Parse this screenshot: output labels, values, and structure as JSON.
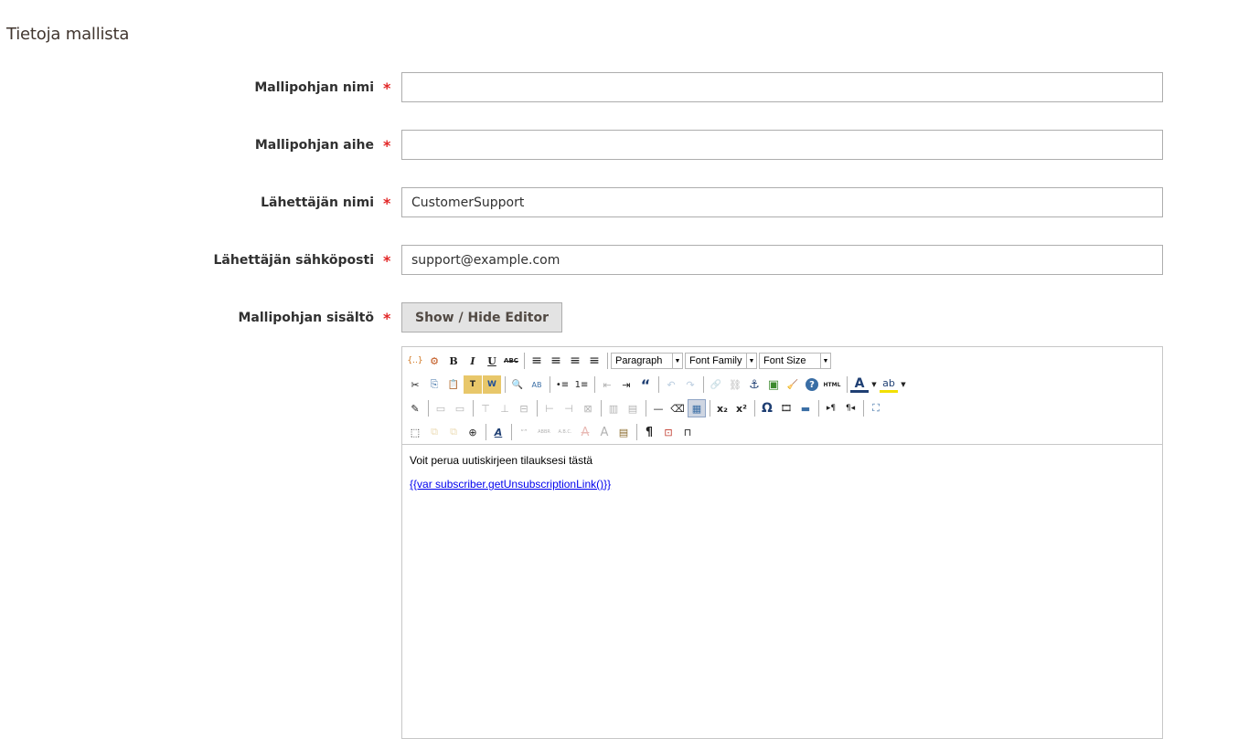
{
  "section": {
    "title": "Tietoja mallista"
  },
  "fields": [
    {
      "label": "Mallipohjan nimi",
      "required_mark": "*",
      "value": "",
      "placeholder": ""
    },
    {
      "label": "Mallipohjan aihe",
      "required_mark": "*",
      "value": "",
      "placeholder": ""
    },
    {
      "label": "Lähettäjän nimi",
      "required_mark": "*",
      "value": "CustomerSupport",
      "placeholder": ""
    },
    {
      "label": "Lähettäjän sähköposti",
      "required_mark": "*",
      "value": "support@example.com",
      "placeholder": ""
    }
  ],
  "content_field": {
    "label": "Mallipohjan sisältö",
    "required_mark": "*",
    "toggle_button": "Show / Hide Editor"
  },
  "toolbar": {
    "row1": {
      "icons": {
        "insert_variable": "{..}",
        "insert_widget": "⚙",
        "bold": "B",
        "italic": "I",
        "underline": "U",
        "strikethrough": "ABC",
        "align_left": "≡",
        "align_center": "≡",
        "align_right": "≡",
        "align_justify": "≡"
      },
      "selects": {
        "format": "Paragraph",
        "font_family": "Font Family",
        "font_size": "Font Size"
      }
    },
    "row2": {
      "icons": {
        "cut": "✂",
        "copy": "⎘",
        "paste": "📋",
        "paste_text": "T",
        "paste_word": "W",
        "find": "🔍",
        "replace": "AB",
        "bullet_list": "•≡",
        "numbered_list": "1≡",
        "outdent": "⇤",
        "indent": "⇥",
        "blockquote": "“",
        "undo": "↶",
        "redo": "↷",
        "link": "🔗",
        "unlink": "⛓",
        "anchor": "⚓",
        "image": "▣",
        "cleanup": "🧹",
        "help": "?",
        "html": "HTML",
        "text_color": "A",
        "background_color": "ab"
      }
    },
    "row3": {
      "icons": {
        "edit_table_props": "✎",
        "row_props": "▭",
        "cell_props": "▭",
        "insert_row_before": "⊤",
        "insert_row_after": "⊥",
        "delete_row": "⊟",
        "insert_col_before": "⊢",
        "insert_col_after": "⊣",
        "delete_col": "⊠",
        "split_cells": "▥",
        "merge_cells": "▤",
        "horizontal_rule": "—",
        "remove_format": "⌫",
        "visual_aid": "▦",
        "subscript": "x₂",
        "superscript": "x²",
        "special_char": "Ω",
        "media": "🎞",
        "advanced_hr": "▬",
        "ltr": "▸¶",
        "rtl": "¶◂",
        "fullscreen": "⛶"
      }
    },
    "row4": {
      "icons": {
        "insert_layer": "⬚",
        "move_forward": "⧉",
        "move_backward": "⧉",
        "absolute": "⊕",
        "styles": "A",
        "cite": "“”",
        "abbr": "ABBR",
        "acronym": "A.B.C.",
        "deletion": "A",
        "insertion": "A",
        "attributes": "▤",
        "show_blocks": "¶",
        "visual_chars": "⊡",
        "nonbreaking": "⊓"
      }
    }
  },
  "editor_content": {
    "paragraph": "Voit perua uutiskirjeen tilauksesi tästä",
    "link": "{{var subscriber.getUnsubscriptionLink()}}"
  },
  "colors": {
    "required": "#e22626",
    "link": "#0000ee",
    "toggle_bg": "#e3e3e3"
  }
}
